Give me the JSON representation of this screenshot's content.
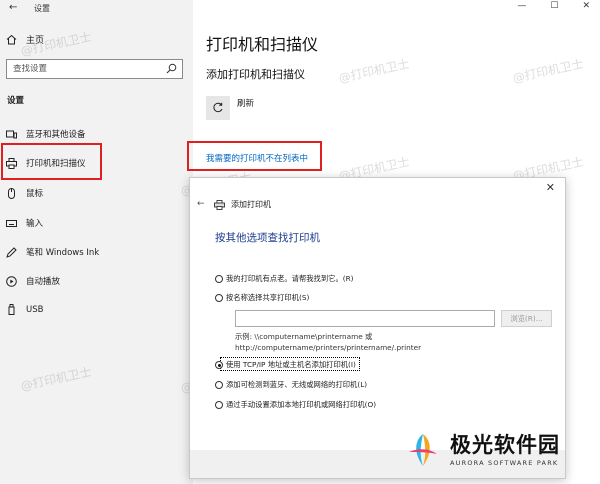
{
  "window": {
    "title": "设置",
    "controls": {
      "minimize": "—",
      "maximize": "☐",
      "close": "✕"
    }
  },
  "sidebar": {
    "home": "主页",
    "search_placeholder": "查找设置",
    "section": "设置",
    "items": [
      {
        "label": "蓝牙和其他设备",
        "icon": "bluetooth-devices-icon"
      },
      {
        "label": "打印机和扫描仪",
        "icon": "printer-icon"
      },
      {
        "label": "鼠标",
        "icon": "mouse-icon"
      },
      {
        "label": "输入",
        "icon": "keyboard-icon"
      },
      {
        "label": "笔和 Windows Ink",
        "icon": "pen-icon"
      },
      {
        "label": "自动播放",
        "icon": "autoplay-icon"
      },
      {
        "label": "USB",
        "icon": "usb-icon"
      }
    ]
  },
  "main": {
    "title": "打印机和扫描仪",
    "subtitle": "添加打印机和扫描仪",
    "refresh": "刷新",
    "not_listed_link": "我需要的打印机不在列表中"
  },
  "dialog": {
    "title": "添加打印机",
    "heading": "按其他选项查找打印机",
    "options": [
      {
        "label": "我的打印机有点老。请帮我找到它。(R)",
        "selected": false
      },
      {
        "label": "按名称选择共享打印机(S)",
        "selected": false
      },
      {
        "label": "使用 TCP/IP 地址或主机名添加打印机(I)",
        "selected": true
      },
      {
        "label": "添加可检测到蓝牙、无线或网络的打印机(L)",
        "selected": false
      },
      {
        "label": "通过手动设置添加本地打印机或网络打印机(O)",
        "selected": false
      }
    ],
    "browse_button": "浏览(R)...",
    "example_line1": "示例: \\\\computername\\printername 或",
    "example_line2": "http://computername/printers/printername/.printer"
  },
  "watermark": "@打印机卫士",
  "brand": {
    "name": "极光软件园",
    "sub": "AURORA SOFTWARE PARK"
  },
  "colors": {
    "highlight": "#e02020",
    "link": "#0067c0",
    "heading": "#1b3d8c"
  }
}
